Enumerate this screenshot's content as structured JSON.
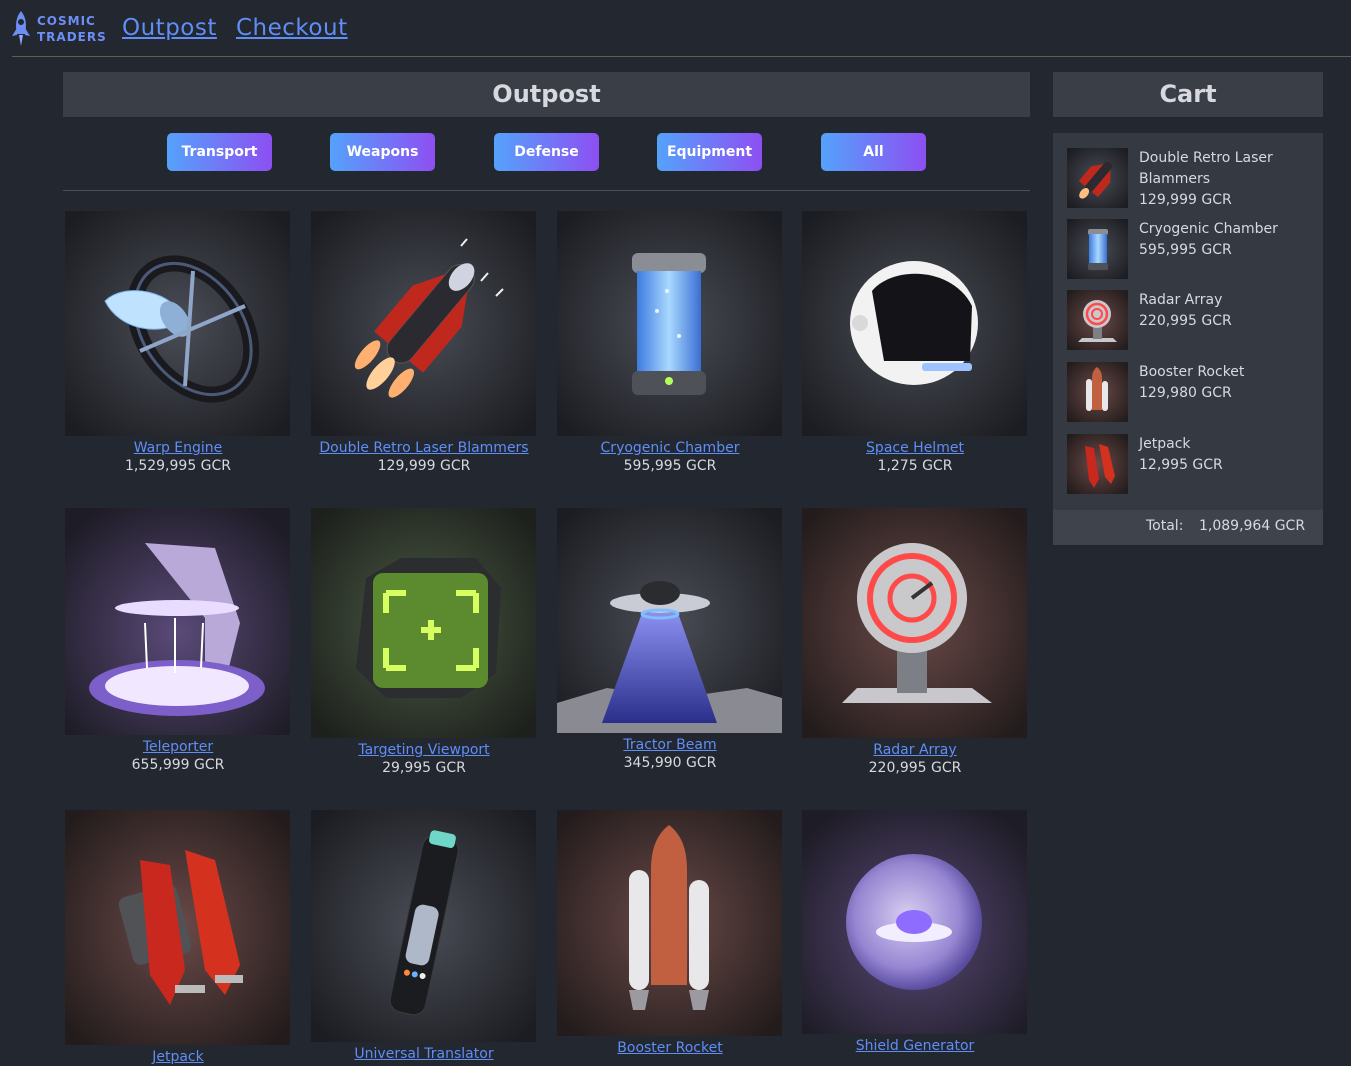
{
  "brand": {
    "line1": "COSMIC",
    "line2": "TRADERS"
  },
  "nav": {
    "outpost": "Outpost",
    "checkout": "Checkout"
  },
  "main": {
    "title": "Outpost"
  },
  "filters": [
    "Transport",
    "Weapons",
    "Defense",
    "Equipment",
    "All"
  ],
  "products": [
    {
      "name": "Warp Engine",
      "price": "1,529,995 GCR"
    },
    {
      "name": "Double Retro Laser Blammers",
      "price": "129,999 GCR"
    },
    {
      "name": "Cryogenic Chamber",
      "price": "595,995 GCR"
    },
    {
      "name": "Space Helmet",
      "price": "1,275 GCR"
    },
    {
      "name": "Teleporter",
      "price": "655,999 GCR"
    },
    {
      "name": "Targeting Viewport",
      "price": "29,995 GCR"
    },
    {
      "name": "Tractor Beam",
      "price": "345,990 GCR"
    },
    {
      "name": "Radar Array",
      "price": "220,995 GCR"
    },
    {
      "name": "Jetpack",
      "price": ""
    },
    {
      "name": "Universal Translator",
      "price": ""
    },
    {
      "name": "Booster Rocket",
      "price": ""
    },
    {
      "name": "Shield Generator",
      "price": ""
    }
  ],
  "cart": {
    "title": "Cart",
    "items": [
      {
        "name": "Double Retro Laser Blammers",
        "price": "129,999 GCR"
      },
      {
        "name": "Cryogenic Chamber",
        "price": "595,995 GCR"
      },
      {
        "name": "Radar Array",
        "price": "220,995 GCR"
      },
      {
        "name": "Booster Rocket",
        "price": "129,980 GCR"
      },
      {
        "name": "Jetpack",
        "price": "12,995 GCR"
      }
    ],
    "total_label": "Total:",
    "total_value": "1,089,964 GCR"
  },
  "colors": {
    "background": "#23272f",
    "panel": "#3a3e47",
    "link": "#5f8ef7",
    "button_gradient_start": "#55a2fb",
    "button_gradient_end": "#8d4ff2"
  }
}
